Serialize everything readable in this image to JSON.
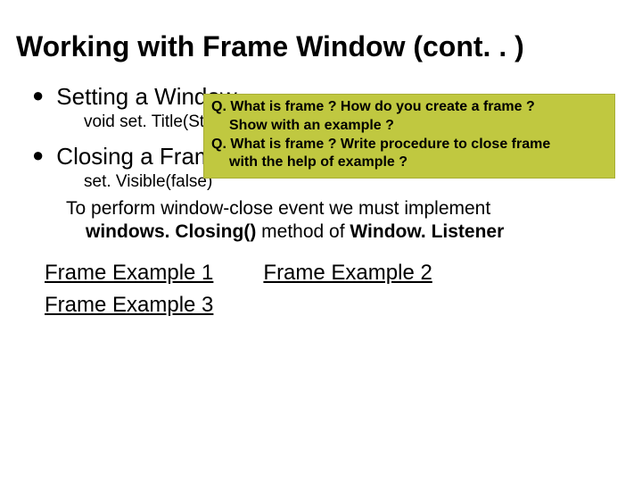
{
  "title": "Working with Frame Window (cont. . )",
  "bullets": {
    "setting": {
      "label": "Setting a Window",
      "sub": "void set. Title(String"
    },
    "closing": {
      "label": "Closing a Frame",
      "sub": "set. Visible(false)",
      "explain_line1": "To perform window-close event we must implement",
      "explain_line2_a": "windows. Closing()",
      "explain_line2_b": " method of  ",
      "explain_line2_c": "Window. Listener"
    }
  },
  "links": {
    "ex1": "Frame Example 1",
    "ex2": "Frame Example 2",
    "ex3": "Frame Example 3"
  },
  "callout": {
    "q1_a": "Q. What is frame ? How do you create a frame ?",
    "q1_b": "Show with an example ?",
    "q2_a": "Q. What is frame ? Write procedure to close frame",
    "q2_b": "with the help of example ?"
  }
}
